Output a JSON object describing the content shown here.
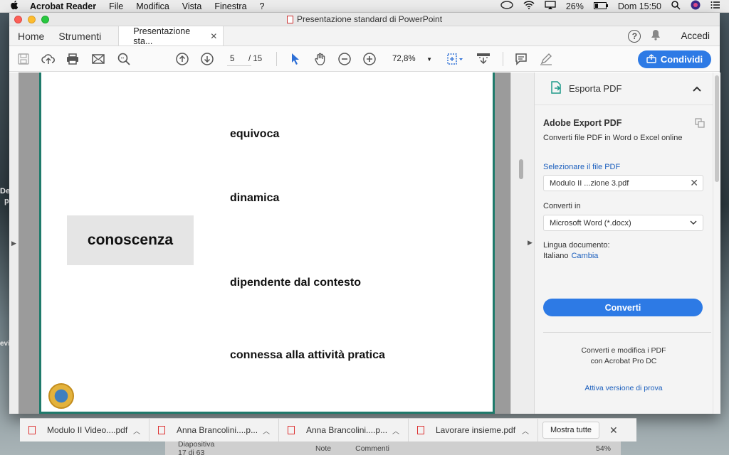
{
  "menubar": {
    "app": "Acrobat Reader",
    "items": [
      "File",
      "Modifica",
      "Vista",
      "Finestra",
      "?"
    ],
    "battery": "26%",
    "clock": "Dom 15:50"
  },
  "desktop": {
    "left_text_1": "De",
    "left_text_2": "p",
    "left_text_3": "evi"
  },
  "window": {
    "title": "Presentazione standard di PowerPoint",
    "nav_home": "Home",
    "nav_tools": "Strumenti",
    "doc_tab": "Presentazione sta...",
    "signin": "Accedi"
  },
  "toolbar": {
    "page_current": "5",
    "page_total": "/ 15",
    "zoom": "72,8%",
    "share": "Condividi"
  },
  "slide": {
    "words": [
      "equivoca",
      "dinamica",
      "dipendente dal contesto",
      "connessa alla attività pratica"
    ],
    "central": "conoscenza"
  },
  "panel": {
    "header": "Esporta PDF",
    "title": "Adobe Export PDF",
    "subtitle": "Converti file PDF in Word o Excel online",
    "select_file": "Selezionare il file PDF",
    "file_name": "Modulo II ...zione 3.pdf",
    "convert_in": "Converti in",
    "format": "Microsoft Word (*.docx)",
    "lang_label": "Lingua documento:",
    "lang_value": "Italiano",
    "lang_change": "Cambia",
    "convert_btn": "Converti",
    "promo_1": "Converti e modifica i PDF",
    "promo_2": "con Acrobat Pro DC",
    "trial": "Attiva versione di prova"
  },
  "downloads": {
    "items": [
      "Modulo II Video....pdf",
      "Anna Brancolini....p...",
      "Anna Brancolini....p...",
      "Lavorare insieme.pdf"
    ],
    "show_all": "Mostra tutte"
  },
  "ppt_status": {
    "slide": "Diapositiva 17 di 63",
    "notes": "Note",
    "comments": "Commenti",
    "zoom": "54%"
  }
}
